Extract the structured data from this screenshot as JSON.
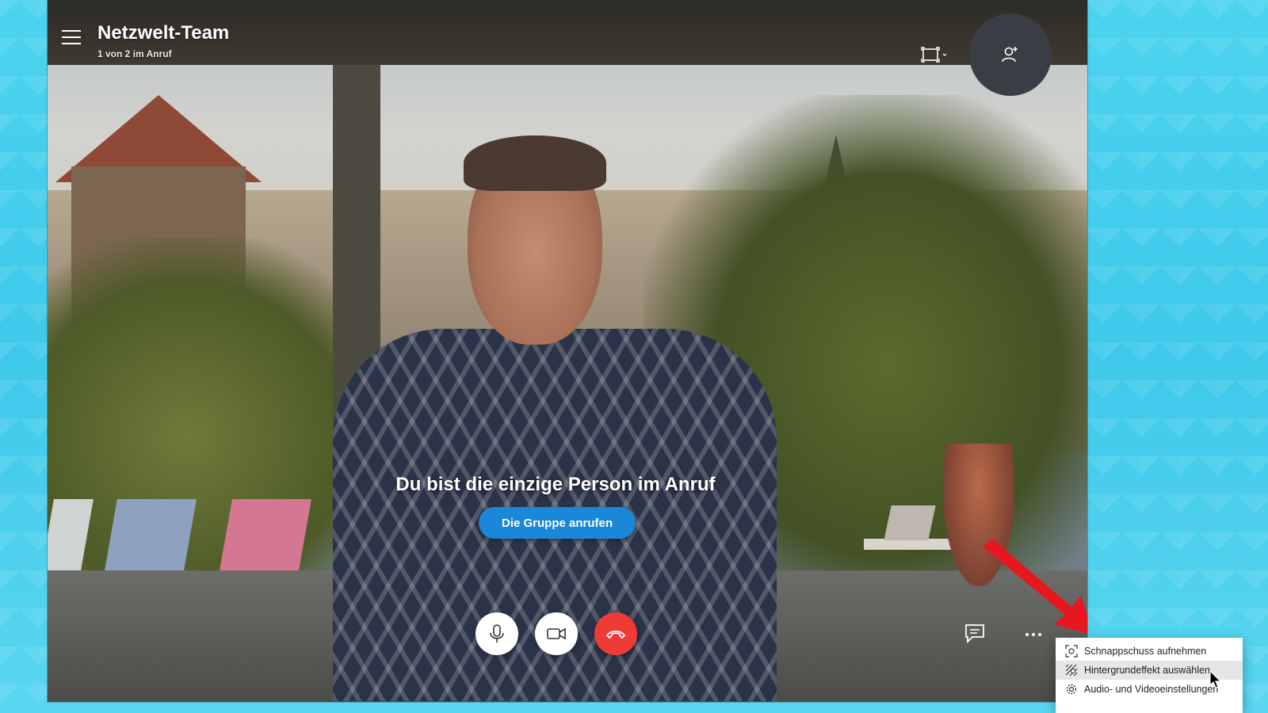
{
  "header": {
    "title": "Netzwelt-Team",
    "subtitle": "1 von 2 im Anruf",
    "menu_icon": "hamburger-menu-icon",
    "view_icon": "screen-layout-icon",
    "add_people_icon": "add-person-icon"
  },
  "main": {
    "message": "Du bist die einzige Person im Anruf",
    "call_group_label": "Die Gruppe anrufen"
  },
  "controls": {
    "mic_icon": "microphone-icon",
    "camera_icon": "video-camera-icon",
    "hangup_icon": "hang-up-icon",
    "chat_icon": "chat-icon",
    "more_icon": "more-options-icon",
    "hangup_color": "#ef3b36"
  },
  "context_menu": {
    "items": [
      {
        "label": "Schnappschuss aufnehmen",
        "icon": "snapshot-icon"
      },
      {
        "label": "Hintergrundeffekt auswählen",
        "icon": "background-effect-icon",
        "highlighted": true
      },
      {
        "label": "Audio- und Videoeinstellungen",
        "icon": "settings-gear-icon"
      }
    ]
  },
  "colors": {
    "accent": "#1a87d8",
    "desktop": "#4cd3ef",
    "annotation": "#e8171f"
  }
}
